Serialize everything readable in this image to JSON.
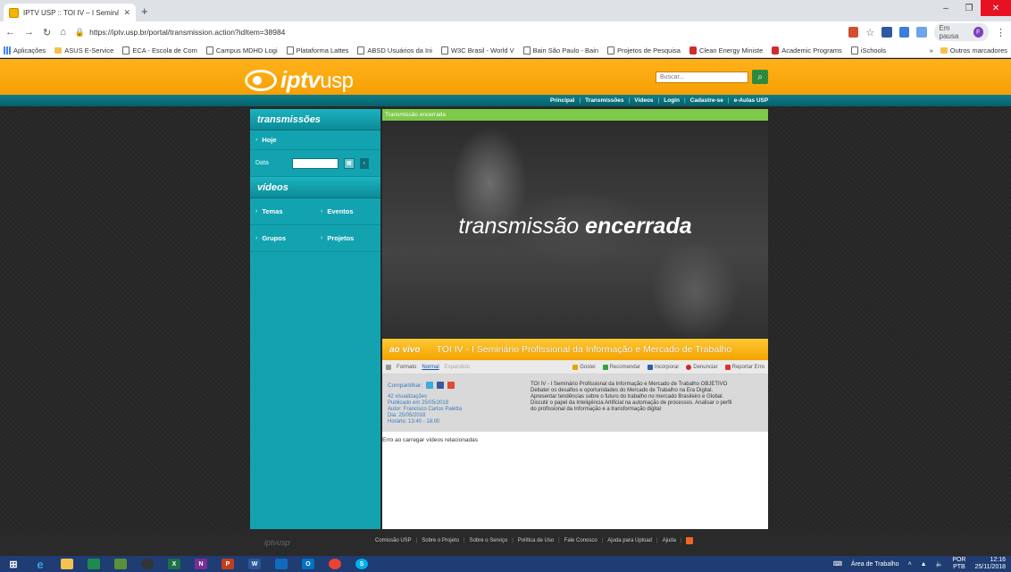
{
  "browser": {
    "tab_title": "IPTV USP :: TOI IV – I Seminário P",
    "url": "https://iptv.usp.br/portal/transmission.action?idItem=38984",
    "pause_label": "Em pausa",
    "profile_initial": "F",
    "bookmarks": [
      "Aplicações",
      "ASUS E-Service",
      "ECA - Escola de Com",
      "Campus MDHD Logi",
      "Plataforma Lattes",
      "ABSD Usuários da Ini",
      "W3C Brasil - World V",
      "Bain São Paulo - Bain",
      "Projetos de Pesquisa",
      "Clean Energy Ministe",
      "Academic Programs",
      "iSchools"
    ],
    "bookmarks_more": "»",
    "other_bookmarks": "Outros marcadores"
  },
  "site": {
    "logo_main": "iptv",
    "logo_sub": "usp",
    "search_placeholder": "Buscar...",
    "topnav": [
      "Principal",
      "Transmissões",
      "Vídeos",
      "Login",
      "Cadastre-se",
      "e-Aulas USP"
    ]
  },
  "sidebar": {
    "transmissions_heading": "transmissões",
    "today": "Hoje",
    "date_label": "Data",
    "videos_heading": "vídeos",
    "themes": "Temas",
    "events": "Eventos",
    "groups": "Grupos",
    "projects": "Projetos"
  },
  "main": {
    "status": "Transmissão encerrada",
    "overlay_light": "transmissão ",
    "overlay_bold": "encerrada",
    "live_label": "ao vivo",
    "video_title": "TOI IV - I Seminário Profissional da Informação e Mercado de Trabalho",
    "format_label": "Formato",
    "format_normal": "Normal",
    "format_expanded": "Expandido",
    "actions": {
      "like": "Gostei",
      "recommend": "Recomendar",
      "embed": "Incorporar",
      "report": "Denunciar",
      "report_error": "Reportar Erro"
    },
    "share_label": "Compartilhar:",
    "meta": [
      "42 visualizações",
      "Publicado em 25/05/2018",
      "Autor: Francisco Carlos Paletta",
      "Dia: 25/05/2018",
      "Horário: 13:40 - 18:00"
    ],
    "description": [
      "TOI IV - I Seminário Profissional da Informação e Mercado de Trabalho OBJETIVO",
      "Debater os desafios e oportunidades do Mercado de Trabalho na Era Digital.",
      "Apresentar tendências sobre o futuro do trabalho no mercado Brasileiro e Global.",
      "Discutir o papel da Inteligência Artificial na automação de processos. Analisar o perfil",
      "do profissional da Informação e a transformação digital"
    ],
    "related_error": "Erro ao carregar vídeos relacionadas"
  },
  "footer": {
    "logo": "iptvusp",
    "links": [
      "Comissão USP",
      "Sobre o Projeto",
      "Sobre o Serviço",
      "Política de Uso",
      "Fale Conosco",
      "Ajuda para Upload",
      "Ajuda"
    ]
  },
  "taskbar": {
    "desktop_label": "Área de Trabalho",
    "lang_top": "POR",
    "lang_bottom": "PTB",
    "time": "12:16",
    "date": "25/11/2018"
  }
}
